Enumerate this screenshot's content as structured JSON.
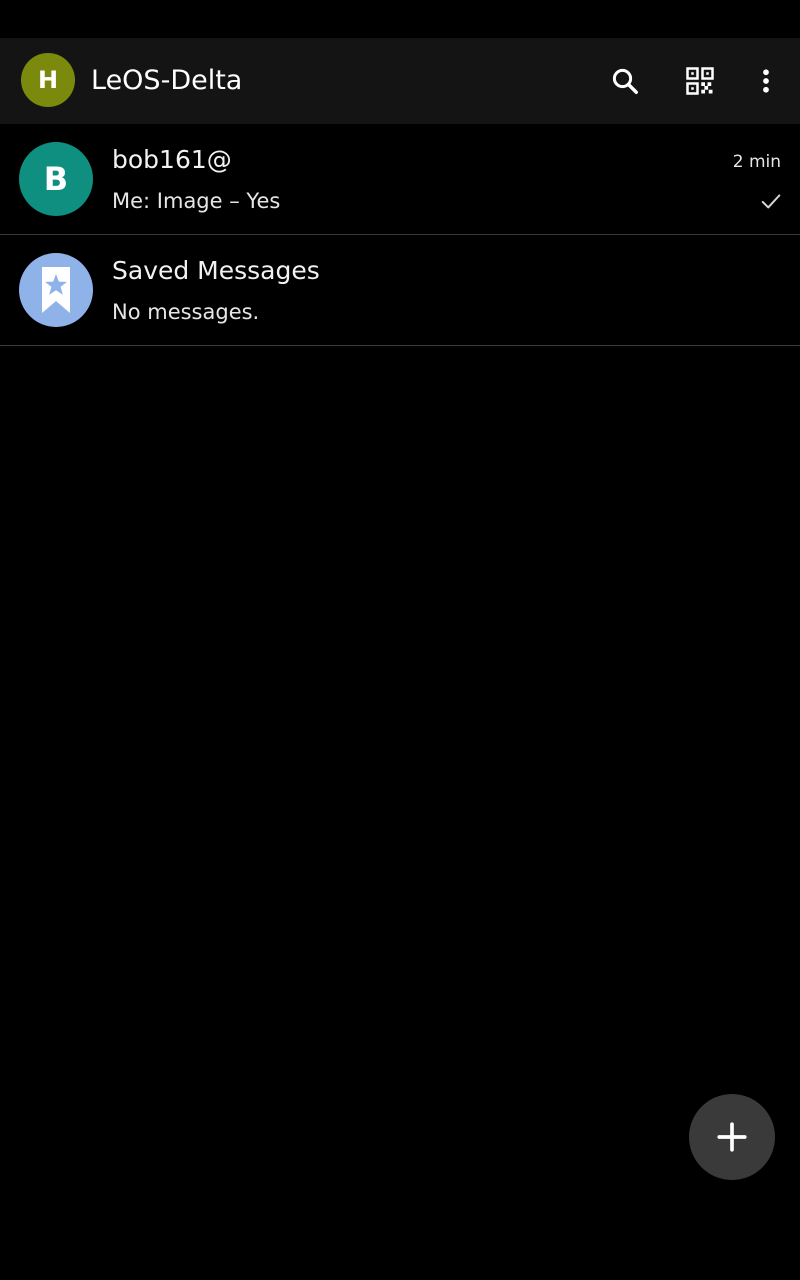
{
  "toolbar": {
    "profile_initial": "H",
    "title": "LeOS-Delta",
    "icons": [
      "search-icon",
      "qr-code-icon",
      "more-vert-icon"
    ]
  },
  "chats": [
    {
      "avatar_initial": "B",
      "name": "bob161@",
      "preview": "Me: Image – Yes",
      "time": "2 min",
      "status_icon": "check-icon"
    },
    {
      "avatar_icon": "bookmark-star-icon",
      "name": "Saved Messages",
      "preview": "No messages."
    }
  ],
  "fab": {
    "icon": "plus-icon"
  },
  "colors": {
    "toolbar_bg": "#141414",
    "profile_avatar": "#7b8a0c",
    "chat_avatar_teal": "#0f8f80",
    "saved_avatar": "#8fb3e8",
    "fab_bg": "#3a3a3a"
  }
}
